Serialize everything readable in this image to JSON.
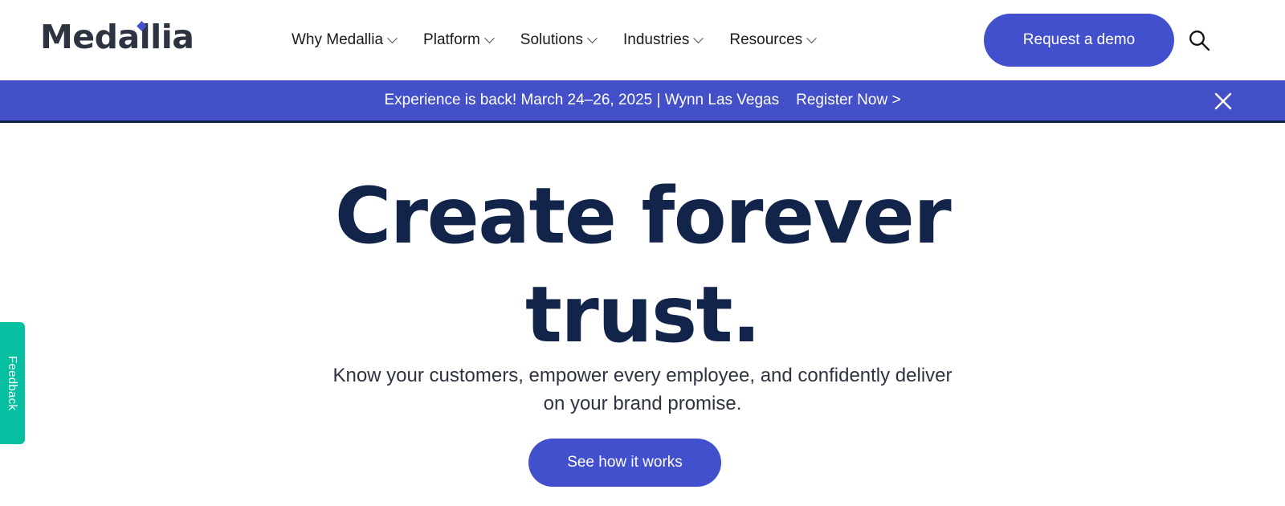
{
  "brand": {
    "logo_text": "Medallia",
    "accent_blue": "#4350c8",
    "button_blue": "#4350ce",
    "headline_navy": "#13244a",
    "feedback_teal": "#06bfa0"
  },
  "header": {
    "nav": [
      {
        "label": "Why Medallia",
        "icon": "chevron-down-icon"
      },
      {
        "label": "Platform",
        "icon": "chevron-down-icon"
      },
      {
        "label": "Solutions",
        "icon": "chevron-down-icon"
      },
      {
        "label": "Industries",
        "icon": "chevron-down-icon"
      },
      {
        "label": "Resources",
        "icon": "chevron-down-icon"
      }
    ],
    "demo_button": "Request a demo",
    "search_icon": "search-icon"
  },
  "banner": {
    "message": "Experience is back! March 24–26, 2025 | Wynn Las Vegas",
    "link": "Register Now >",
    "close_icon": "close-icon"
  },
  "hero": {
    "title": "Create forever trust.",
    "subtitle": "Know your customers, empower every employee, and confidently deliver on your brand promise.",
    "cta": "See how it works"
  },
  "feedback": {
    "label": "Feedback"
  }
}
